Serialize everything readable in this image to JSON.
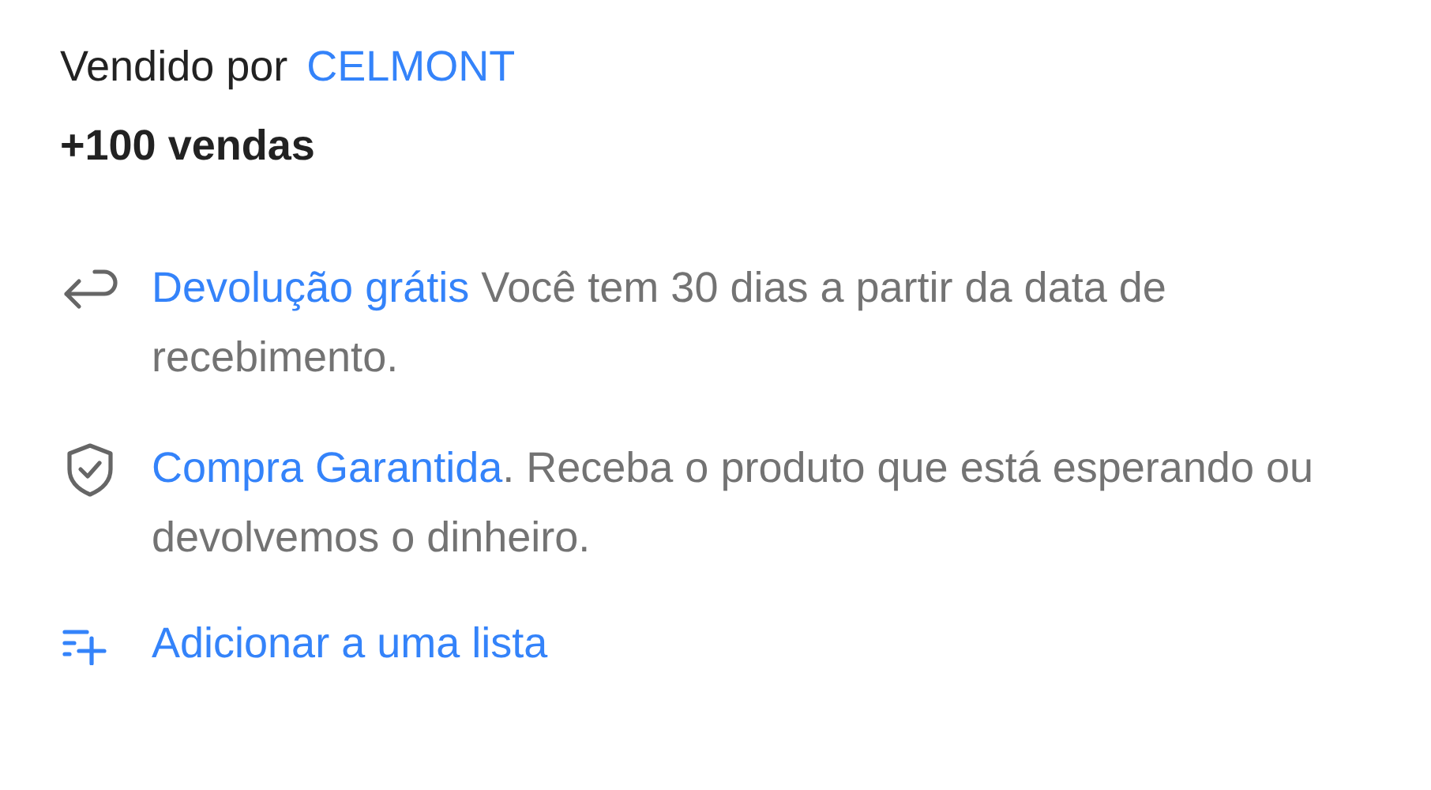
{
  "seller": {
    "label": "Vendido por",
    "name": "CELMONT"
  },
  "sales": "+100 vendas",
  "benefits": [
    {
      "kind": "return",
      "link": "Devolução grátis",
      "text": " Você tem 30 dias a partir da data de recebimento."
    },
    {
      "kind": "guarantee",
      "link": "Compra Garantida",
      "text": ". Receba o produto que está esperando ou devolvemos o dinheiro."
    }
  ],
  "list_action": {
    "label": "Adicionar a uma lista"
  }
}
